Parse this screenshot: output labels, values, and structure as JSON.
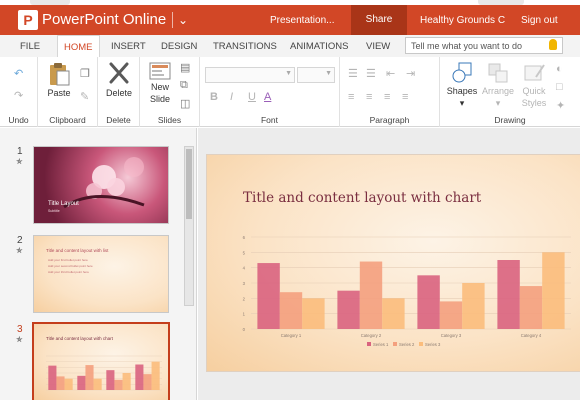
{
  "app": {
    "name": "PowerPoint Online",
    "logo_letter": "P"
  },
  "titlebar": {
    "filename": "Presentation...",
    "share_label": "Share",
    "account": "Healthy Grounds C...",
    "signout_label": "Sign out"
  },
  "tabs": [
    "FILE",
    "HOME",
    "INSERT",
    "DESIGN",
    "TRANSITIONS",
    "ANIMATIONS",
    "VIEW"
  ],
  "active_tab": "HOME",
  "tell_me_placeholder": "Tell me what you want to do",
  "ribbon": {
    "groups": {
      "undo": "Undo",
      "clipboard": "Clipboard",
      "delete": "Delete",
      "slides": "Slides",
      "font": "Font",
      "paragraph": "Paragraph",
      "drawing": "Drawing"
    },
    "buttons": {
      "paste": "Paste",
      "delete": "Delete",
      "new_slide_line1": "New",
      "new_slide_line2": "Slide",
      "shapes": "Shapes",
      "arrange": "Arrange",
      "quick_styles_line1": "Quick",
      "quick_styles_line2": "Styles"
    },
    "font_buttons": [
      "B",
      "I",
      "U",
      "A"
    ]
  },
  "slides": [
    {
      "number": "1",
      "title": "Title Layout",
      "subtitle": "Subtitle"
    },
    {
      "number": "2",
      "title": "Title and content layout with list",
      "bullets": [
        "Add your first bullet point here",
        "Add your second bullet point here",
        "Add your third bullet point here"
      ]
    },
    {
      "number": "3",
      "title": "Title and content layout with chart"
    }
  ],
  "current_slide": {
    "title": "Title and content layout with chart",
    "chart_data": {
      "type": "bar",
      "title": "",
      "categories": [
        "Category 1",
        "Category 2",
        "Category 3",
        "Category 4"
      ],
      "series": [
        {
          "name": "Series 1",
          "values": [
            4.3,
            2.5,
            3.5,
            4.5
          ]
        },
        {
          "name": "Series 2",
          "values": [
            2.4,
            4.4,
            1.8,
            2.8
          ]
        },
        {
          "name": "Series 3",
          "values": [
            2.0,
            2.0,
            3.0,
            5.0
          ]
        }
      ],
      "ylim": [
        0,
        6
      ],
      "yticks": [
        "0",
        "1",
        "2",
        "3",
        "4",
        "5",
        "6"
      ],
      "legend": "bottom",
      "colors": [
        "#d9637f",
        "#f4a07e",
        "#fbbd7c"
      ],
      "grid": true
    }
  },
  "colors": {
    "brand": "#d24726",
    "share_bg": "#a93518",
    "selected_outline": "#c43e1c"
  }
}
